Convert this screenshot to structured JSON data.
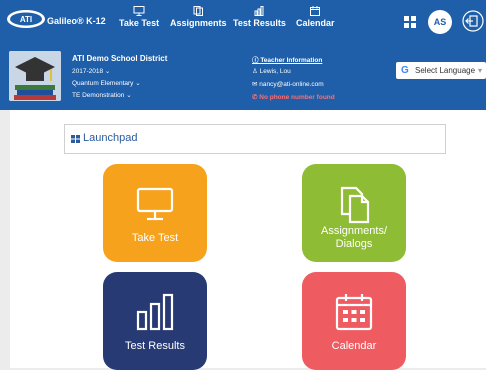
{
  "brand": {
    "logo_text": "ATI",
    "name": "Galileo® K-12"
  },
  "nav": [
    {
      "label": "Take Test",
      "icon": "monitor-icon"
    },
    {
      "label": "Assignments",
      "icon": "docs-icon"
    },
    {
      "label": "Test Results",
      "icon": "bar-chart-icon"
    },
    {
      "label": "Calendar",
      "icon": "calendar-icon"
    }
  ],
  "user": {
    "initials": "AS"
  },
  "school": {
    "district": "ATI Demo School District",
    "year": "2017-2018",
    "school": "Quantum Elementary",
    "mode": "TE Demonstration"
  },
  "teacher": {
    "title": "Teacher Information",
    "name": "Lewis, Lou",
    "email": "nancy@ati-online.com",
    "phone": "No phone number found"
  },
  "language": {
    "label": "Select Language"
  },
  "launchpad": {
    "title": "Launchpad"
  },
  "tiles": [
    {
      "label": "Take Test",
      "color": "#f7a21c"
    },
    {
      "label": "Assignments/ Dialogs",
      "color": "#8ebc34"
    },
    {
      "label": "Test Results",
      "color": "#283a74"
    },
    {
      "label": "Calendar",
      "color": "#ee5c62"
    }
  ],
  "colors": {
    "header": "#1f5ea8",
    "phone_alert": "#ff6f6f"
  }
}
